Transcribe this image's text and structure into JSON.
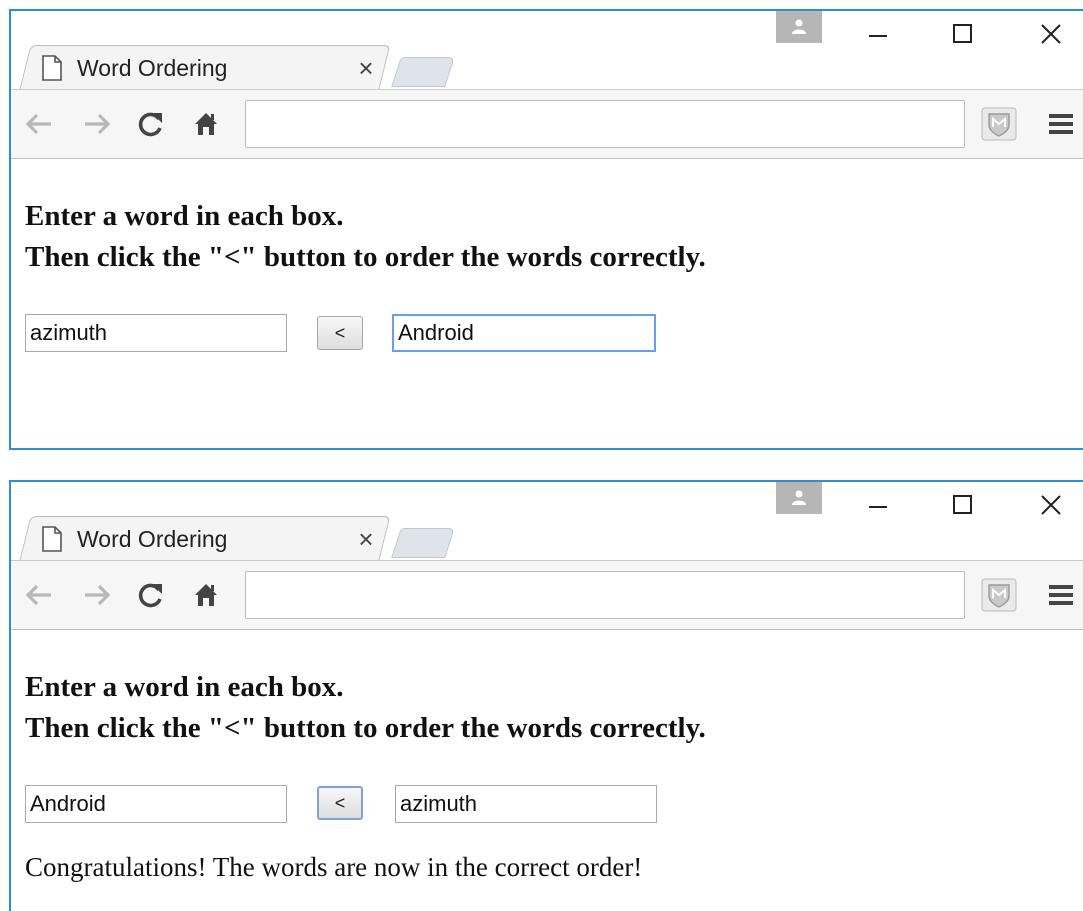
{
  "screens": [
    {
      "tab_title": "Word Ordering",
      "heading_line1": "Enter a word in each box.",
      "heading_line2": "Then click the \"<\" button to order the words correctly.",
      "first_word": "azimuth",
      "second_word": "Android",
      "order_button_label": "<",
      "focused": "second_word",
      "result_message": ""
    },
    {
      "tab_title": "Word Ordering",
      "heading_line1": "Enter a word in each box.",
      "heading_line2": "Then click the \"<\" button to order the words correctly.",
      "first_word": "Android",
      "second_word": "azimuth",
      "order_button_label": "<",
      "focused": "order_button",
      "result_message": "Congratulations! The words are now in the correct order!"
    }
  ],
  "browser": {
    "tab_close_glyph": "×",
    "address_value": ""
  },
  "icons": [
    "page-icon",
    "close-icon",
    "profile-icon",
    "minimize-icon",
    "maximize-icon",
    "window-close-icon",
    "back-arrow-icon",
    "forward-arrow-icon",
    "reload-icon",
    "home-icon",
    "extension-shield-icon",
    "menu-icon"
  ],
  "colors": {
    "window_border": "#2d8fd0",
    "focus_ring": "#6a9ee8",
    "disabled_nav": "#b8b8b8"
  }
}
